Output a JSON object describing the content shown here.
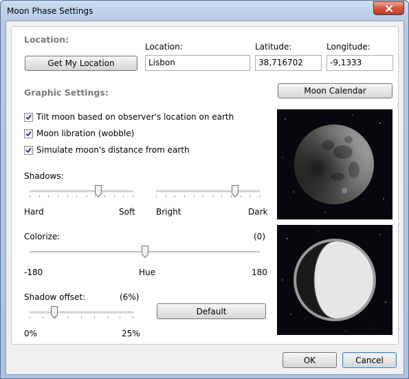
{
  "window": {
    "title": "Moon Phase Settings"
  },
  "location": {
    "section_title": "Location:",
    "get_location_label": "Get My Location",
    "location_label": "Location:",
    "location_value": "Lisbon",
    "latitude_label": "Latitude:",
    "latitude_value": "38,716702",
    "longitude_label": "Longitude:",
    "longitude_value": "-9,1333"
  },
  "graphic": {
    "section_title": "Graphic Settings:",
    "moon_calendar_label": "Moon Calendar",
    "checkboxes": [
      {
        "label": "Tilt moon based on observer's location on earth",
        "checked": true
      },
      {
        "label": "Moon libration (wobble)",
        "checked": true
      },
      {
        "label": "Simulate moon's distance from earth",
        "checked": true
      }
    ],
    "shadows": {
      "label": "Shadows:",
      "hardness": {
        "left": "Hard",
        "right": "Soft",
        "value": 0.66
      },
      "brightness": {
        "left": "Bright",
        "right": "Dark",
        "value": 0.76
      }
    },
    "colorize": {
      "label": "Colorize:",
      "value_text": "(0)",
      "min": "-180",
      "mid": "Hue",
      "max": "180",
      "value": 0
    },
    "shadow_offset": {
      "label": "Shadow offset:",
      "value_text": "(6%)",
      "min": "0%",
      "max": "25%",
      "value": 6
    },
    "default_label": "Default"
  },
  "buttons": {
    "ok": "OK",
    "cancel": "Cancel"
  },
  "colors": {
    "title_bar": "#b4cbe6",
    "close_button": "#c9452d",
    "moon_background": "#06080d"
  }
}
